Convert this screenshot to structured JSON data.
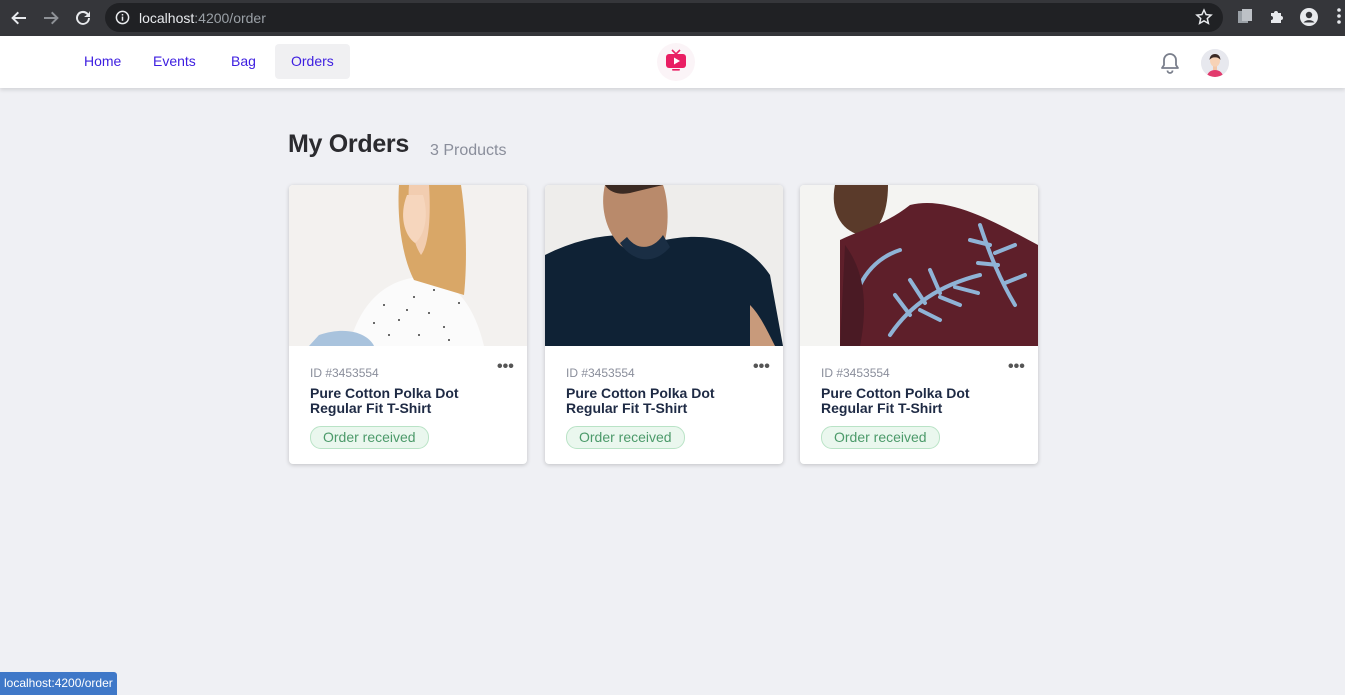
{
  "browser": {
    "url_host": "localhost",
    "url_path": ":4200/order",
    "status_url": "localhost:4200/order"
  },
  "nav": {
    "items": [
      {
        "label": "Home"
      },
      {
        "label": "Events"
      },
      {
        "label": "Bag"
      },
      {
        "label": "Orders",
        "active": true
      }
    ]
  },
  "colors": {
    "accent": "#3d1ee0",
    "logo": "#e91e63",
    "status_badge": "#4c9a6a"
  },
  "page": {
    "title": "My Orders",
    "product_count": "3 Products"
  },
  "orders": [
    {
      "id": "ID #3453554",
      "name": "Pure Cotton Polka Dot Regular Fit T-Shirt",
      "status": "Order received",
      "image": "woman-polka-dot-shirt"
    },
    {
      "id": "ID #3453554",
      "name": "Pure Cotton Polka Dot Regular Fit T-Shirt",
      "status": "Order received",
      "image": "man-navy-polo"
    },
    {
      "id": "ID #3453554",
      "name": "Pure Cotton Polka Dot Regular Fit T-Shirt",
      "status": "Order received",
      "image": "man-leaf-print-shirt"
    }
  ],
  "icons": {
    "more": "•••"
  }
}
